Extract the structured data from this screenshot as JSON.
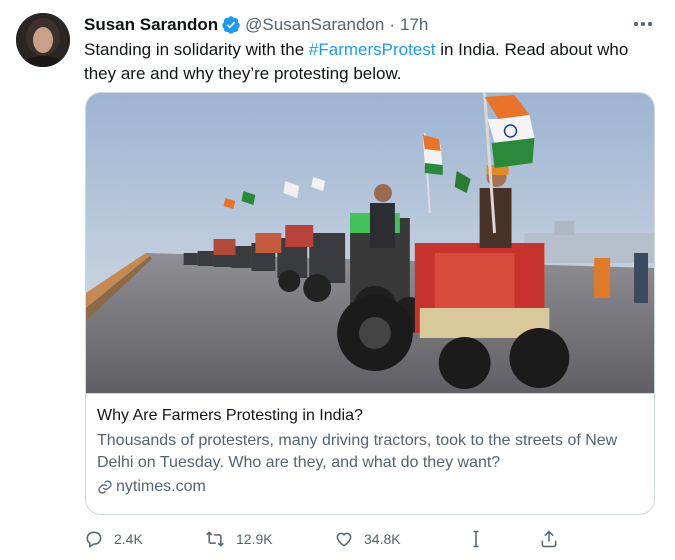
{
  "tweet": {
    "author_name": "Susan Sarandon",
    "handle": "@SusanSarandon",
    "separator": "·",
    "time": "17h",
    "text_before": "Standing in solidarity with the ",
    "hashtag": "#FarmersProtest",
    "text_after": " in India. Read about who they are and why they’re protesting below."
  },
  "card": {
    "title": "Why Are Farmers Protesting in India?",
    "description": "Thousands of protesters, many driving tractors, took to the streets of New Delhi on Tuesday. Who are they, and what do they want?",
    "domain": "nytimes.com"
  },
  "actions": {
    "replies": "2.4K",
    "retweets": "12.9K",
    "likes": "34.8K"
  },
  "icons": [
    "verified-badge-icon",
    "more-icon",
    "link-icon",
    "reply-icon",
    "retweet-icon",
    "like-icon",
    "media-icon",
    "share-icon"
  ],
  "colors": {
    "accent": "#1d9bf0",
    "secondary_text": "#536471",
    "border": "#cfd9de"
  }
}
